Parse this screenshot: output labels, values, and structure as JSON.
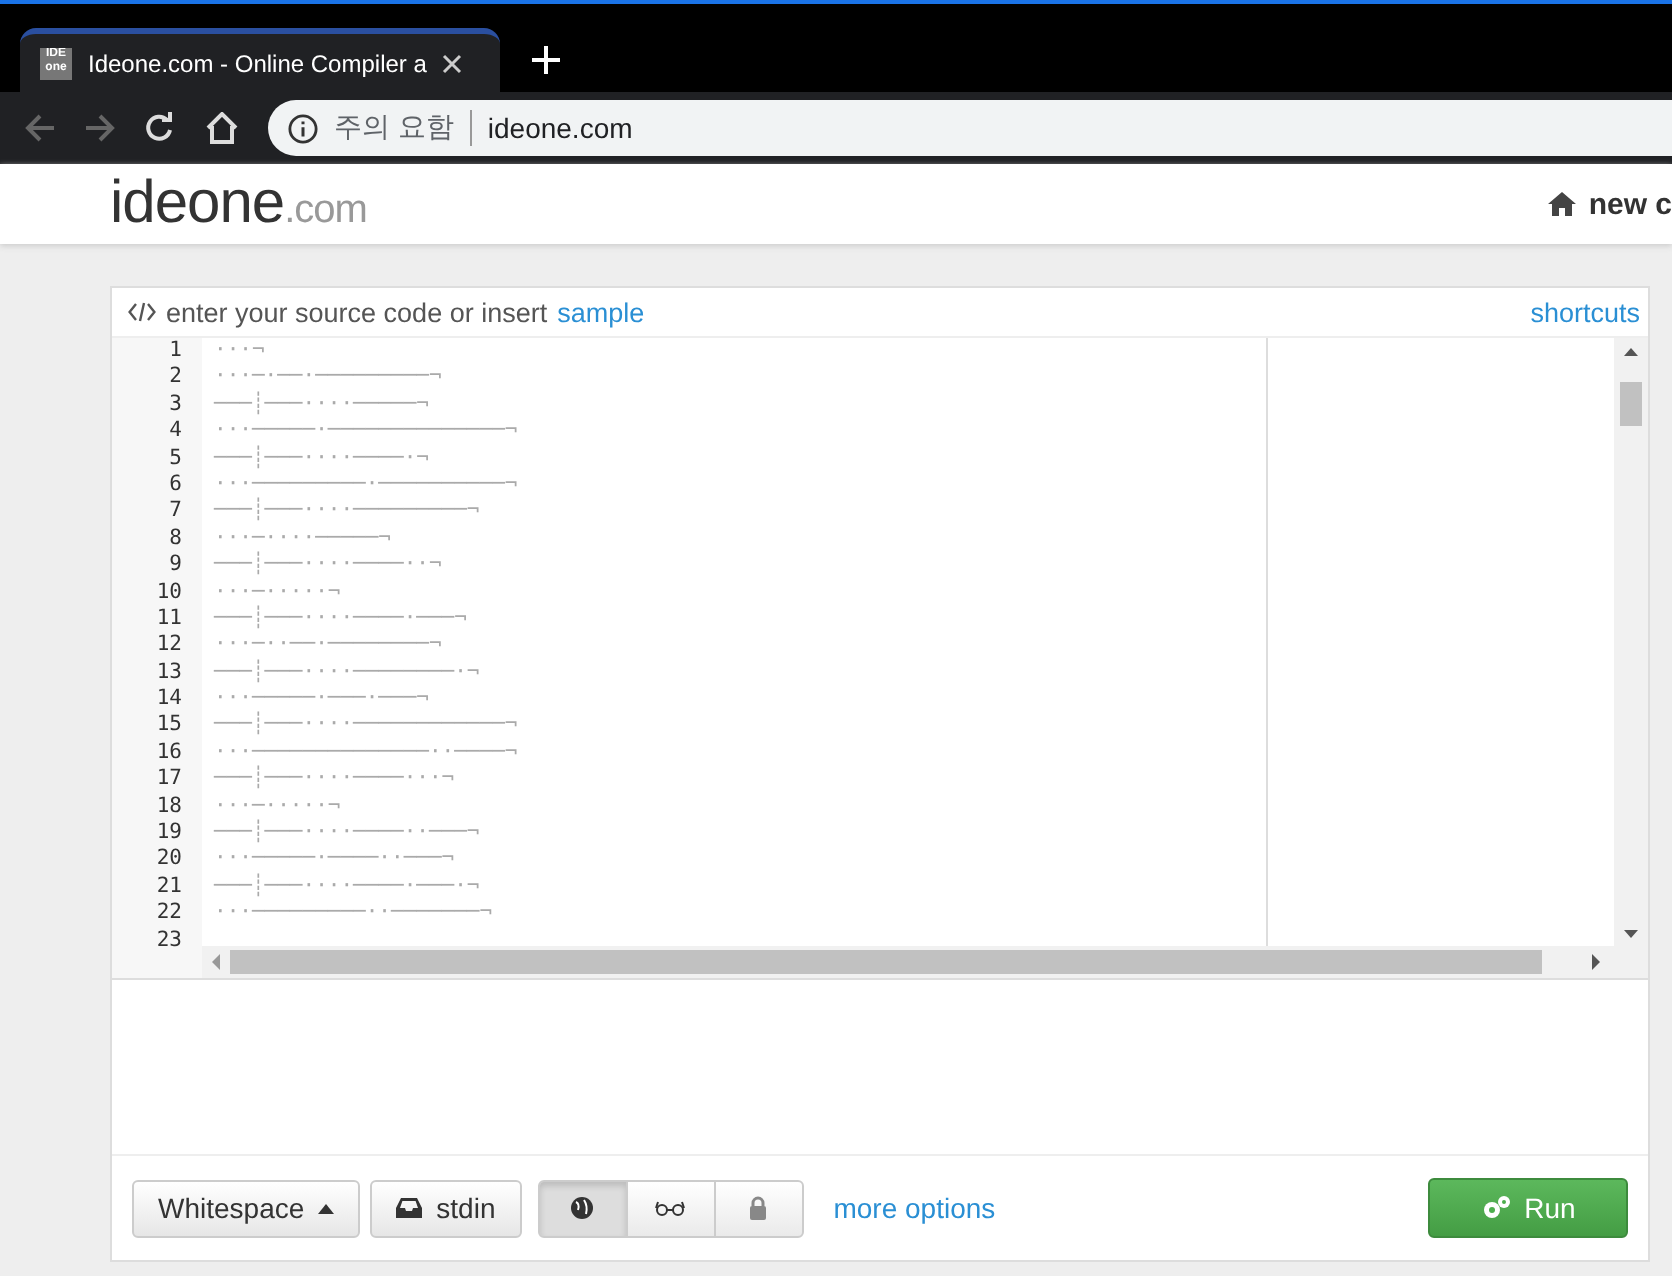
{
  "browser": {
    "tab_title": "Ideone.com - Online Compiler a",
    "favicon": "IDE one",
    "security_label": "주의 요함",
    "url": "ideone.com"
  },
  "site": {
    "logo": "ideone",
    "logo_suffix": ".com",
    "nav_link": "new c"
  },
  "editor": {
    "header_text": "enter your source code or insert",
    "sample_link": "sample",
    "shortcuts_link": "shortcuts",
    "lines": [
      {
        "number": "1",
        "text": "···¬"
      },
      {
        "number": "2",
        "text": "···─·──·─────────¬"
      },
      {
        "number": "3",
        "text": "───┊───····─────¬"
      },
      {
        "number": "4",
        "text": "···─────·──────────────¬"
      },
      {
        "number": "5",
        "text": "───┊───····────·¬"
      },
      {
        "number": "6",
        "text": "···─────────·──────────¬"
      },
      {
        "number": "7",
        "text": "───┊───····─────────¬"
      },
      {
        "number": "8",
        "text": "···─····─────¬"
      },
      {
        "number": "9",
        "text": "───┊───····────··¬"
      },
      {
        "number": "10",
        "text": "···─·····¬"
      },
      {
        "number": "11",
        "text": "───┊───····────·───¬"
      },
      {
        "number": "12",
        "text": "···─··──·────────¬"
      },
      {
        "number": "13",
        "text": "───┊───····────────·¬"
      },
      {
        "number": "14",
        "text": "···─────·───·───¬"
      },
      {
        "number": "15",
        "text": "───┊───····────────────¬"
      },
      {
        "number": "16",
        "text": "···──────────────··────¬"
      },
      {
        "number": "17",
        "text": "───┊───····────···¬"
      },
      {
        "number": "18",
        "text": "···─·····¬"
      },
      {
        "number": "19",
        "text": "───┊───····────··───¬"
      },
      {
        "number": "20",
        "text": "···─────·────··───¬"
      },
      {
        "number": "21",
        "text": "───┊───····────·───·¬"
      },
      {
        "number": "22",
        "text": "···─────────··───────¬"
      },
      {
        "number": "23"
      }
    ]
  },
  "toolbar": {
    "language_button": "Whitespace",
    "stdin_button": "stdin",
    "visibility": [
      {
        "kind": "public",
        "selected": true
      },
      {
        "kind": "hidden",
        "selected": false
      },
      {
        "kind": "private",
        "selected": false
      }
    ],
    "more_options": "more options",
    "run_button": "Run"
  }
}
